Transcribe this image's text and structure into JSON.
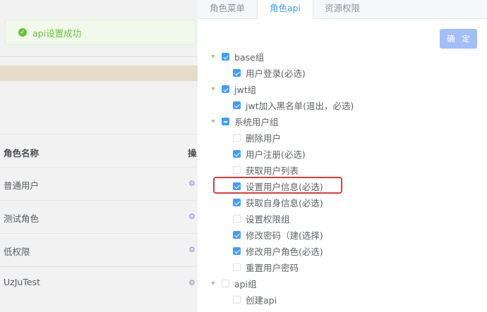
{
  "toast": {
    "message": "api设置成功"
  },
  "background_table": {
    "headers": [
      "角色名称",
      "操"
    ],
    "rows": [
      "普通用户",
      "测试角色",
      "低权限",
      "UzJuTest"
    ]
  },
  "drawer": {
    "tabs": [
      {
        "label": "角色菜单",
        "active": false
      },
      {
        "label": "角色api",
        "active": true
      },
      {
        "label": "资源权限",
        "active": false
      }
    ],
    "confirm_label": "确 定",
    "tree": [
      {
        "level": 0,
        "label": "base组",
        "state": "checked",
        "expandable": true
      },
      {
        "level": 1,
        "label": "用户登录(必选)",
        "state": "checked"
      },
      {
        "level": 0,
        "label": "jwt组",
        "state": "checked",
        "expandable": true
      },
      {
        "level": 1,
        "label": "jwt加入黑名单(退出，必选)",
        "state": "checked"
      },
      {
        "level": 0,
        "label": "系统用户组",
        "state": "indeterminate",
        "expandable": true
      },
      {
        "level": 1,
        "label": "删除用户",
        "state": "unchecked"
      },
      {
        "level": 1,
        "label": "用户注册(必选)",
        "state": "checked"
      },
      {
        "level": 1,
        "label": "获取用户列表",
        "state": "unchecked"
      },
      {
        "level": 1,
        "label": "设置用户信息(必选)",
        "state": "checked"
      },
      {
        "level": 1,
        "label": "获取自身信息(必选)",
        "state": "checked"
      },
      {
        "level": 1,
        "label": "设置权限组",
        "state": "unchecked"
      },
      {
        "level": 1,
        "label": "修改密码（建(选择)",
        "state": "checked"
      },
      {
        "level": 1,
        "label": "修改用户角色(必选)",
        "state": "checked"
      },
      {
        "level": 1,
        "label": "重置用户密码",
        "state": "unchecked"
      },
      {
        "level": 0,
        "label": "api组",
        "state": "unchecked",
        "expandable": true
      },
      {
        "level": 1,
        "label": "创建api",
        "state": "unchecked"
      }
    ]
  },
  "colors": {
    "primary": "#409eff",
    "success": "#67c23a",
    "highlight": "#e03a3a"
  }
}
